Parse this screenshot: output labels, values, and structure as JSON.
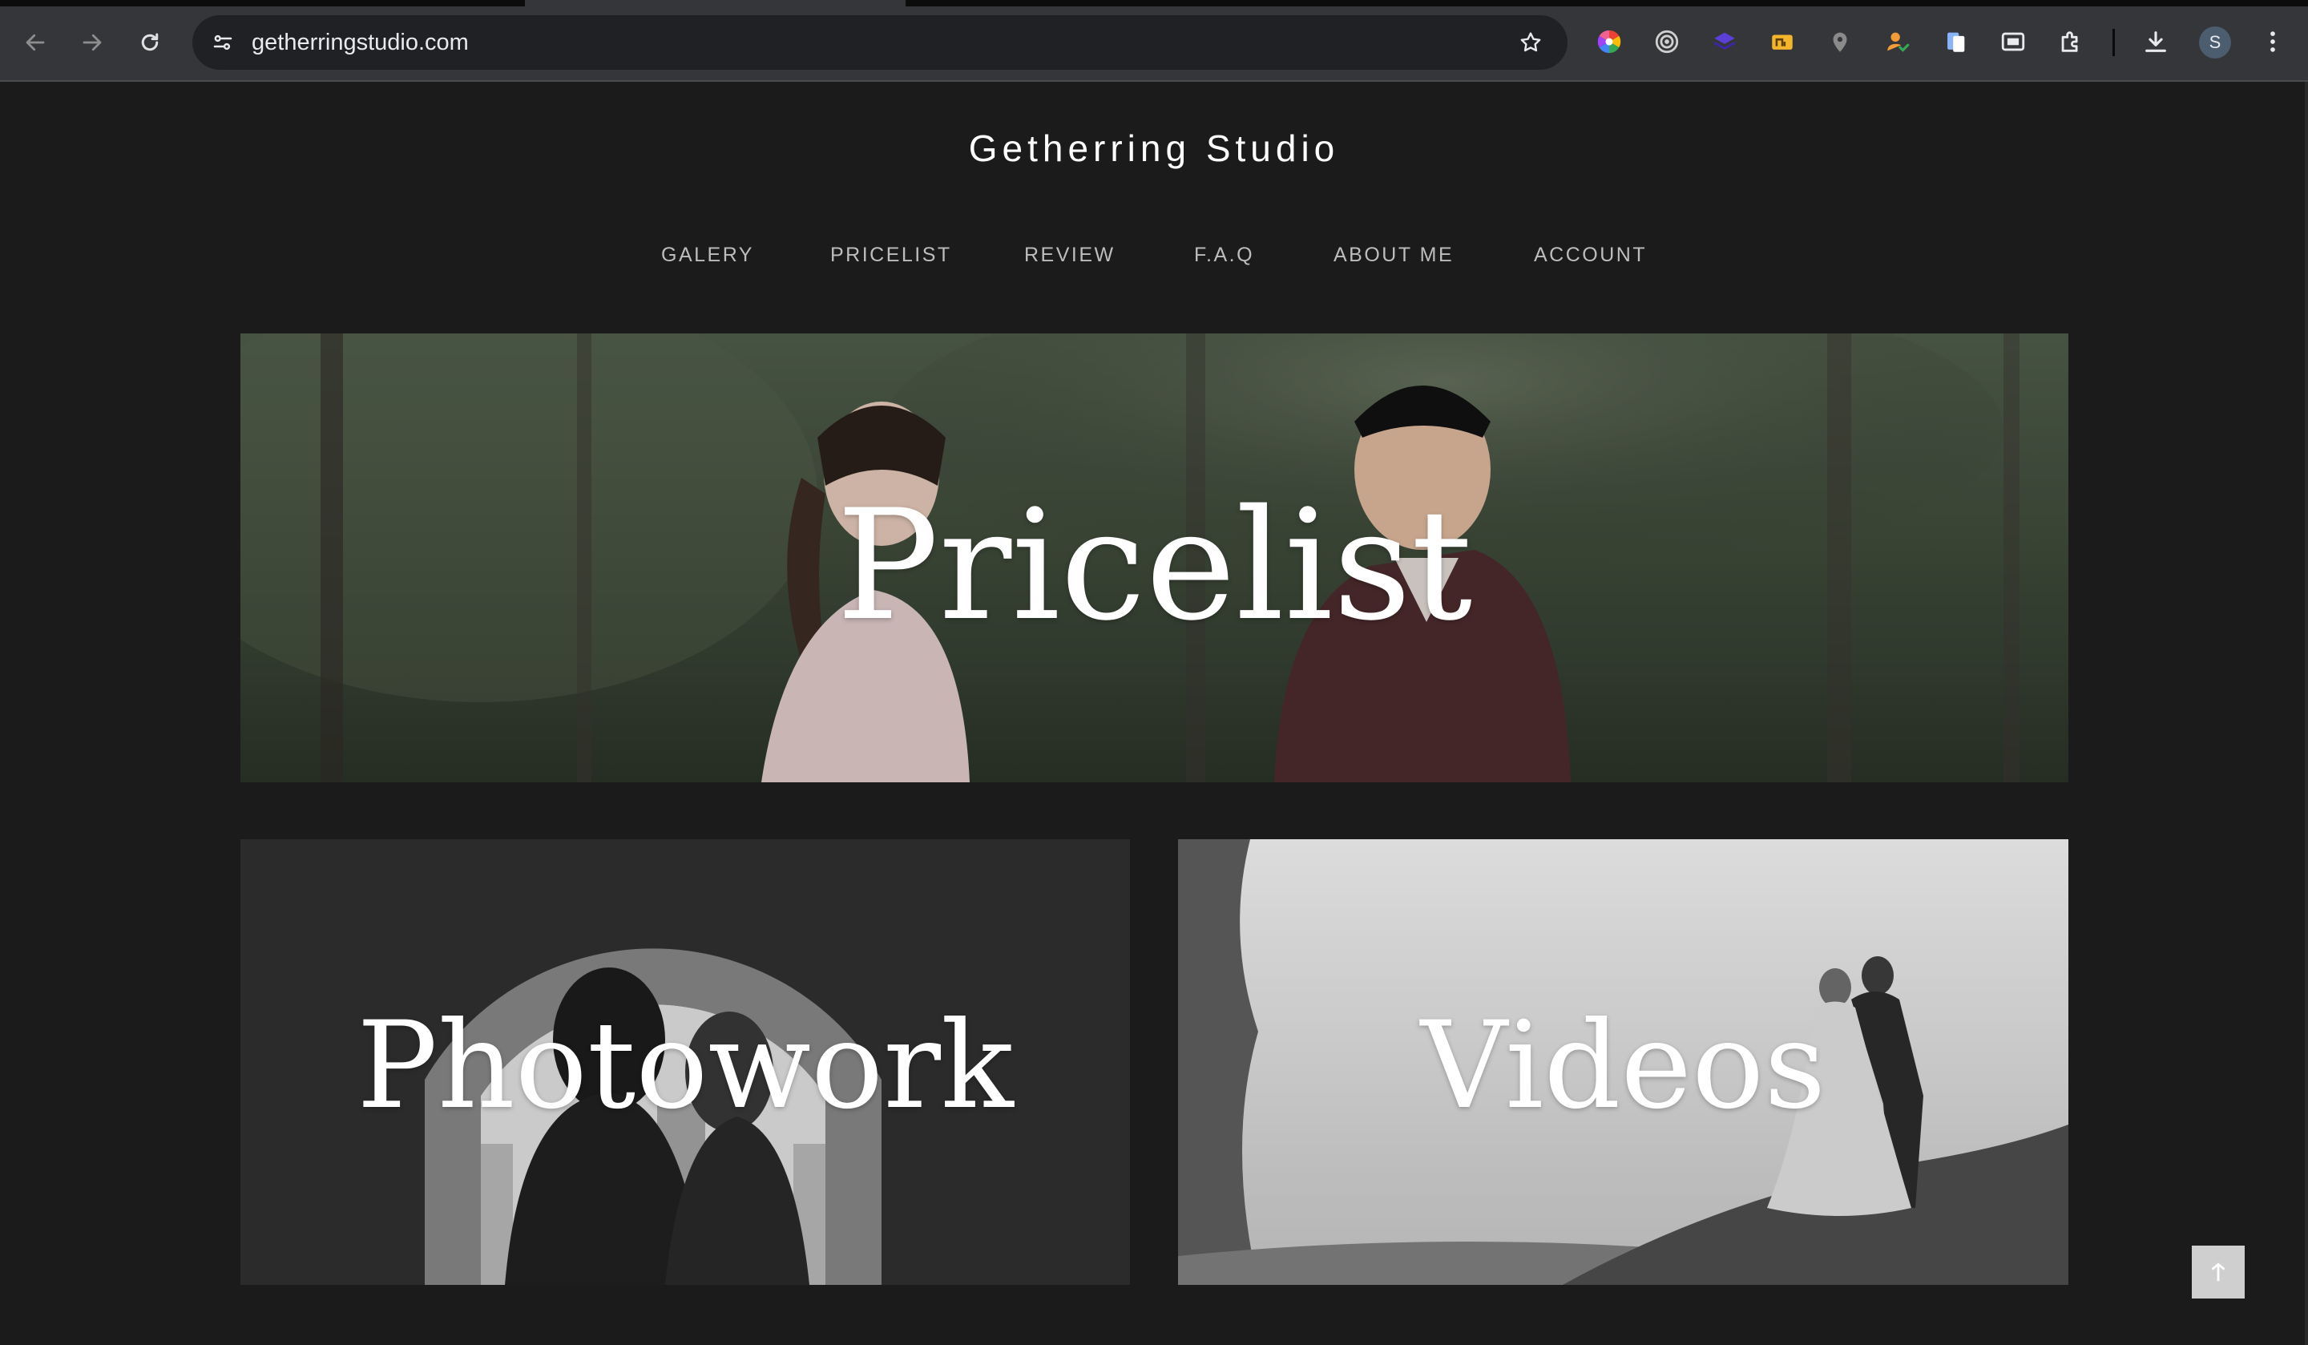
{
  "browser": {
    "url": "getherringstudio.com",
    "profile_initial": "S",
    "extensions": [
      "color-wheel-icon",
      "target-icon",
      "layers-icon",
      "yellow-box-icon",
      "map-pin-icon",
      "person-check-icon",
      "blue-files-icon",
      "window-icon",
      "puzzle-icon"
    ]
  },
  "site": {
    "brand": "Getherring Studio",
    "menu": [
      "GALERY",
      "PRICELIST",
      "REVIEW",
      "F.A.Q",
      "ABOUT ME",
      "ACCOUNT"
    ]
  },
  "tiles": {
    "pricelist": "Pricelist",
    "photowork": "Photowork",
    "videos": "Videos"
  },
  "colors": {
    "page_bg": "#1b1b1c",
    "chrome_bg": "#35363a",
    "omnibox_bg": "#202124"
  }
}
